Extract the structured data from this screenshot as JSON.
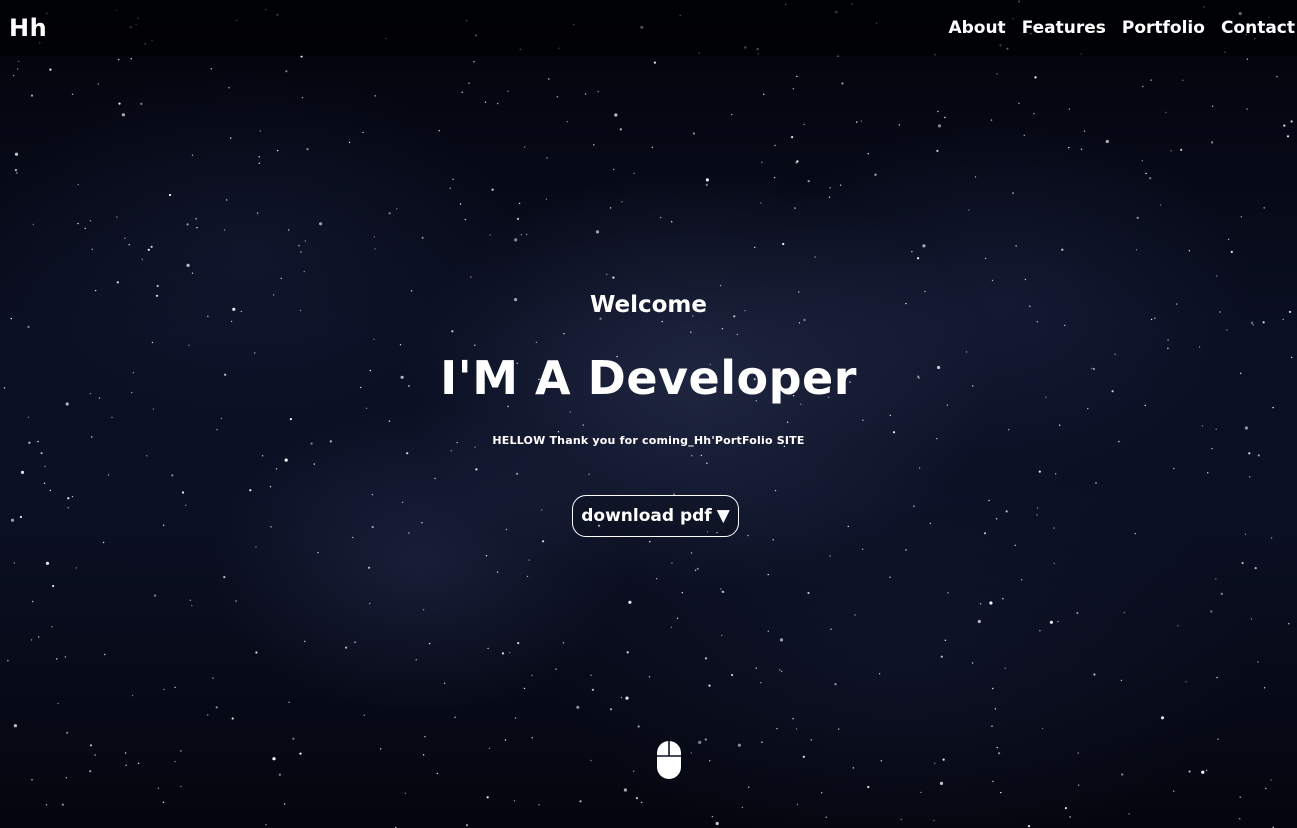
{
  "header": {
    "logo": "Hh",
    "nav": [
      {
        "label": "About"
      },
      {
        "label": "Features"
      },
      {
        "label": "Portfolio"
      },
      {
        "label": "Contact"
      }
    ]
  },
  "hero": {
    "welcome": "Welcome",
    "headline": "I'M A Developer",
    "tagline": "HELLOW Thank you for coming_Hh'PortFolio SITE",
    "download_label": "download pdf",
    "download_arrow": "▼"
  },
  "icons": {
    "scroll": "mouse-icon",
    "download": "triangle-down-icon"
  },
  "colors": {
    "text": "#ffffff",
    "background": "#05070f"
  }
}
